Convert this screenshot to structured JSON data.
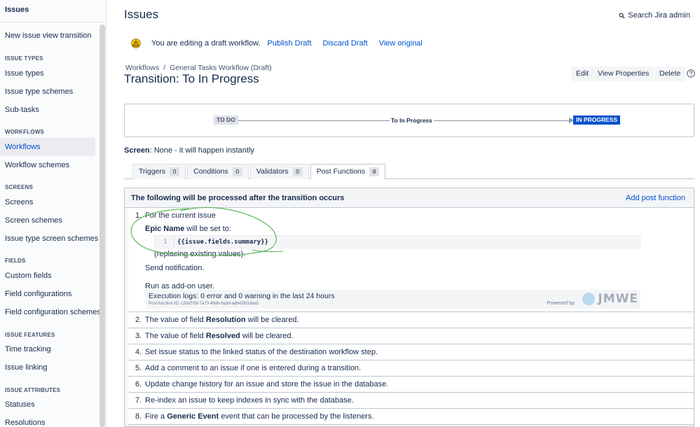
{
  "sidebar": {
    "title": "Issues",
    "items": [
      {
        "label": "New issue view transition"
      },
      {
        "heading": "ISSUE TYPES"
      },
      {
        "label": "Issue types"
      },
      {
        "label": "Issue type schemes"
      },
      {
        "label": "Sub-tasks"
      },
      {
        "heading": "WORKFLOWS"
      },
      {
        "label": "Workflows",
        "active": true
      },
      {
        "label": "Workflow schemes"
      },
      {
        "heading": "SCREENS"
      },
      {
        "label": "Screens"
      },
      {
        "label": "Screen schemes"
      },
      {
        "label": "Issue type screen schemes"
      },
      {
        "heading": "FIELDS"
      },
      {
        "label": "Custom fields"
      },
      {
        "label": "Field configurations"
      },
      {
        "label": "Field configuration schemes"
      },
      {
        "heading": "ISSUE FEATURES"
      },
      {
        "label": "Time tracking"
      },
      {
        "label": "Issue linking"
      },
      {
        "heading": "ISSUE ATTRIBUTES"
      },
      {
        "label": "Statuses"
      },
      {
        "label": "Resolutions"
      }
    ]
  },
  "header": {
    "title": "Issues",
    "search_admin": "Search Jira admin"
  },
  "draft": {
    "message": "You are editing a draft workflow.",
    "publish": "Publish Draft",
    "discard": "Discard Draft",
    "view_original": "View original"
  },
  "breadcrumb": {
    "workflows": "Workflows",
    "separator": "/",
    "current": "General Tasks Workflow (Draft)"
  },
  "transition": {
    "title": "Transition: To In Progress",
    "edit": "Edit",
    "view_properties": "View Properties",
    "delete": "Delete"
  },
  "diagram": {
    "from": "TO DO",
    "label": "To In Progress",
    "to": "IN PROGRESS"
  },
  "screen": {
    "label": "Screen",
    "value": ": None - it will happen instantly"
  },
  "tabs": [
    {
      "label": "Triggers",
      "count": "0"
    },
    {
      "label": "Conditions",
      "count": "0"
    },
    {
      "label": "Validators",
      "count": "0"
    },
    {
      "label": "Post Functions",
      "count": "8",
      "active": true
    }
  ],
  "post_functions": {
    "header": "The following will be processed after the transition occurs",
    "add": "Add post function",
    "first": {
      "num": "1.",
      "scope": "For the current issue",
      "field": "Epic Name",
      "set_to": " will be set to:",
      "code_line": "1",
      "code": "{{issue.fields.summary}}",
      "replacing": "(replacing existing values).",
      "notification": "Send notification.",
      "addon": "Run as add-on user.",
      "exec_logs": "Execution logs: 0 error and 0 warning in the last 24 hours",
      "post_function_id": "Post-function ID: c2bd705f-7a73-49db-9a3d-adb42fd1daa5",
      "powered_by": "Powered by",
      "logo": "JMWE"
    },
    "rows": [
      {
        "num": "2.",
        "pre": "The value of field ",
        "bold": "Resolution",
        "post": " will be cleared."
      },
      {
        "num": "3.",
        "pre": "The value of field ",
        "bold": "Resolved",
        "post": " will be cleared."
      },
      {
        "num": "4.",
        "pre": "Set issue status to the linked status of the destination workflow step.",
        "bold": "",
        "post": ""
      },
      {
        "num": "5.",
        "pre": "Add a comment to an issue if one is entered during a transition.",
        "bold": "",
        "post": ""
      },
      {
        "num": "6.",
        "pre": "Update change history for an issue and store the issue in the database.",
        "bold": "",
        "post": ""
      },
      {
        "num": "7.",
        "pre": "Re-index an issue to keep indexes in sync with the database.",
        "bold": "",
        "post": ""
      },
      {
        "num": "8.",
        "pre": "Fire a ",
        "bold": "Generic Event",
        "post": " event that can be processed by the listeners."
      }
    ]
  },
  "colors": {
    "link": "#0052cc",
    "annotation": "#5fb85b"
  }
}
